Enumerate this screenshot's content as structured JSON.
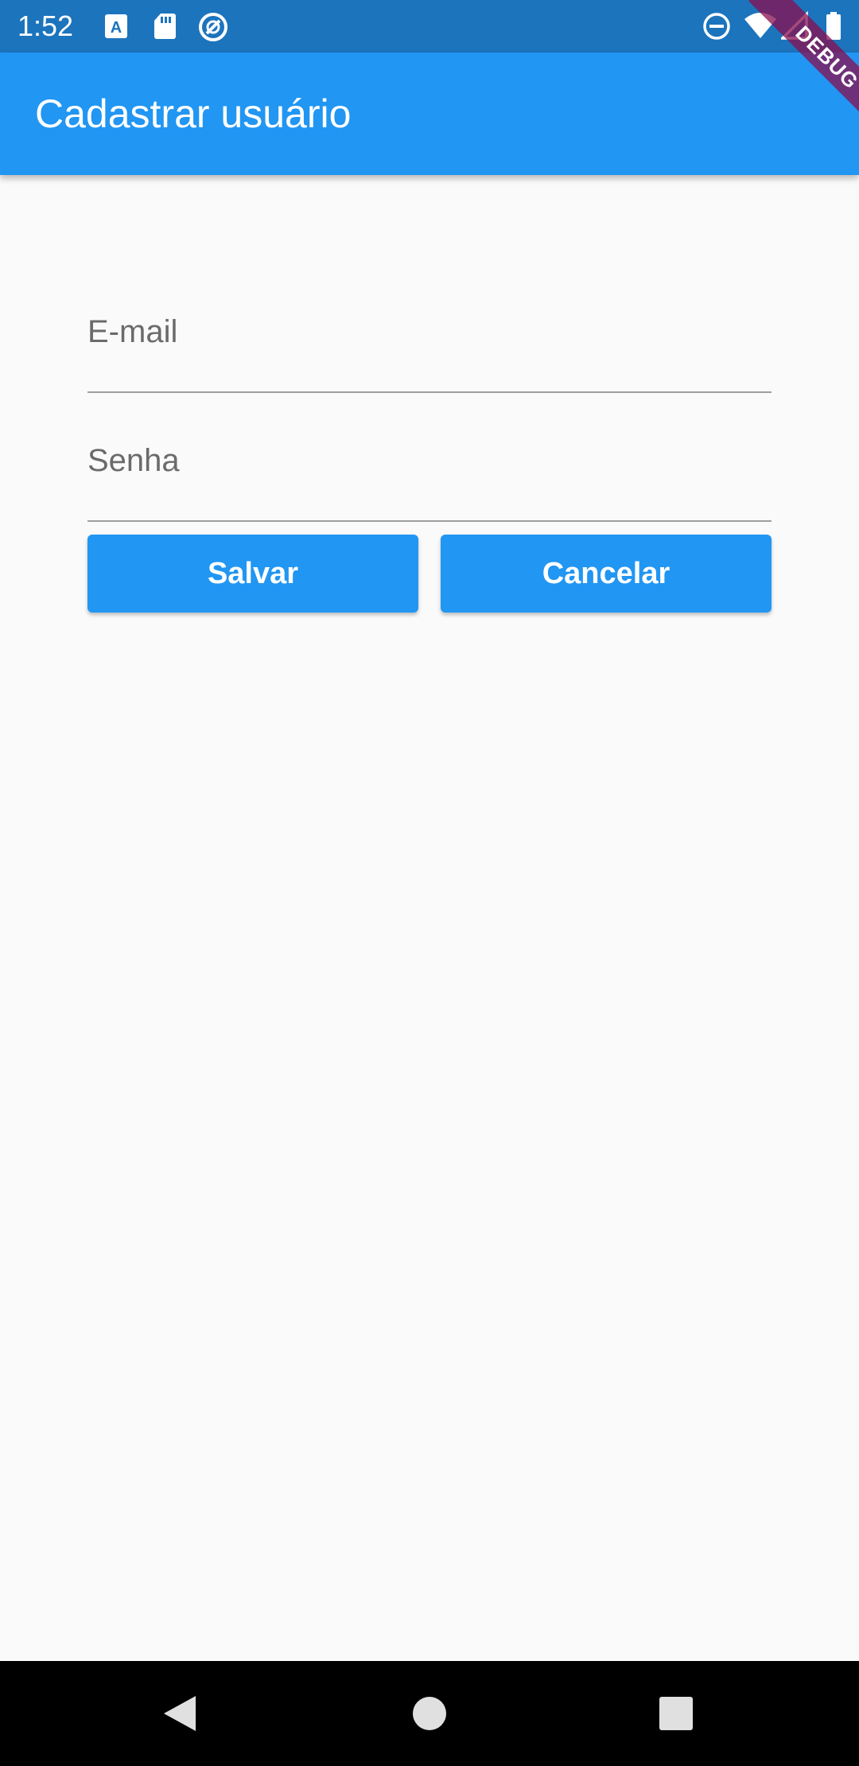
{
  "status_bar": {
    "time": "1:52",
    "background": "#1c74bd",
    "left_icons": [
      "font-download-icon",
      "sd-card-icon",
      "sync-circle-icon"
    ],
    "right_icons": [
      "do-not-disturb-icon",
      "wifi-icon",
      "signal-icon",
      "battery-icon"
    ]
  },
  "app_bar": {
    "title": "Cadastrar usuário",
    "background": "#2196f3"
  },
  "debug_banner": {
    "label": "DEBUG",
    "color": "#880e4f"
  },
  "form": {
    "email": {
      "label": "E-mail",
      "value": ""
    },
    "senha": {
      "label": "Senha",
      "value": ""
    },
    "save_label": "Salvar",
    "cancel_label": "Cancelar",
    "button_color": "#2196f3"
  },
  "nav_bar": {
    "buttons": [
      "back-icon",
      "home-icon",
      "recents-icon"
    ]
  }
}
